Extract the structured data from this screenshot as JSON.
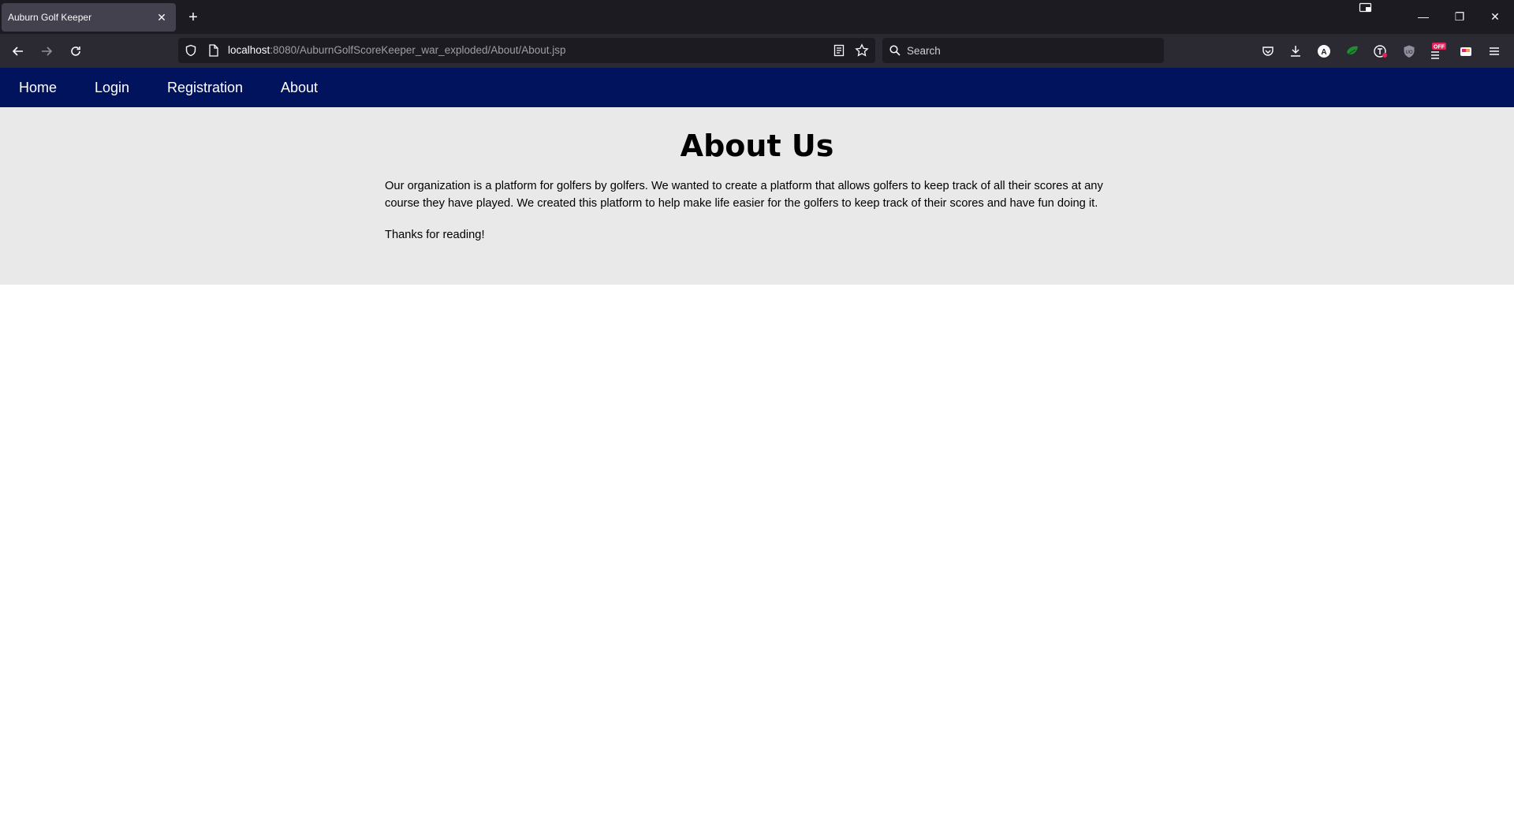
{
  "browser": {
    "tab_title": "Auburn Golf Keeper",
    "url_host": "localhost",
    "url_rest": ":8080/AuburnGolfScoreKeeper_war_exploded/About/About.jsp",
    "search_placeholder": "Search"
  },
  "site_nav": {
    "items": [
      {
        "label": "Home"
      },
      {
        "label": "Login"
      },
      {
        "label": "Registration"
      },
      {
        "label": "About"
      }
    ]
  },
  "about": {
    "title": "About Us",
    "paragraph": "Our organization is a platform for golfers by golfers. We wanted to create a platform that allows golfers to keep track of all their scores at any course they have played. We created this platform to help make life easier for the golfers to keep track of their scores and have fun doing it.",
    "closing": "Thanks for reading!"
  },
  "colors": {
    "nav_background": "#02135e",
    "content_background": "#e9e9e9"
  },
  "icons": {
    "addon_badge": "OFF"
  }
}
